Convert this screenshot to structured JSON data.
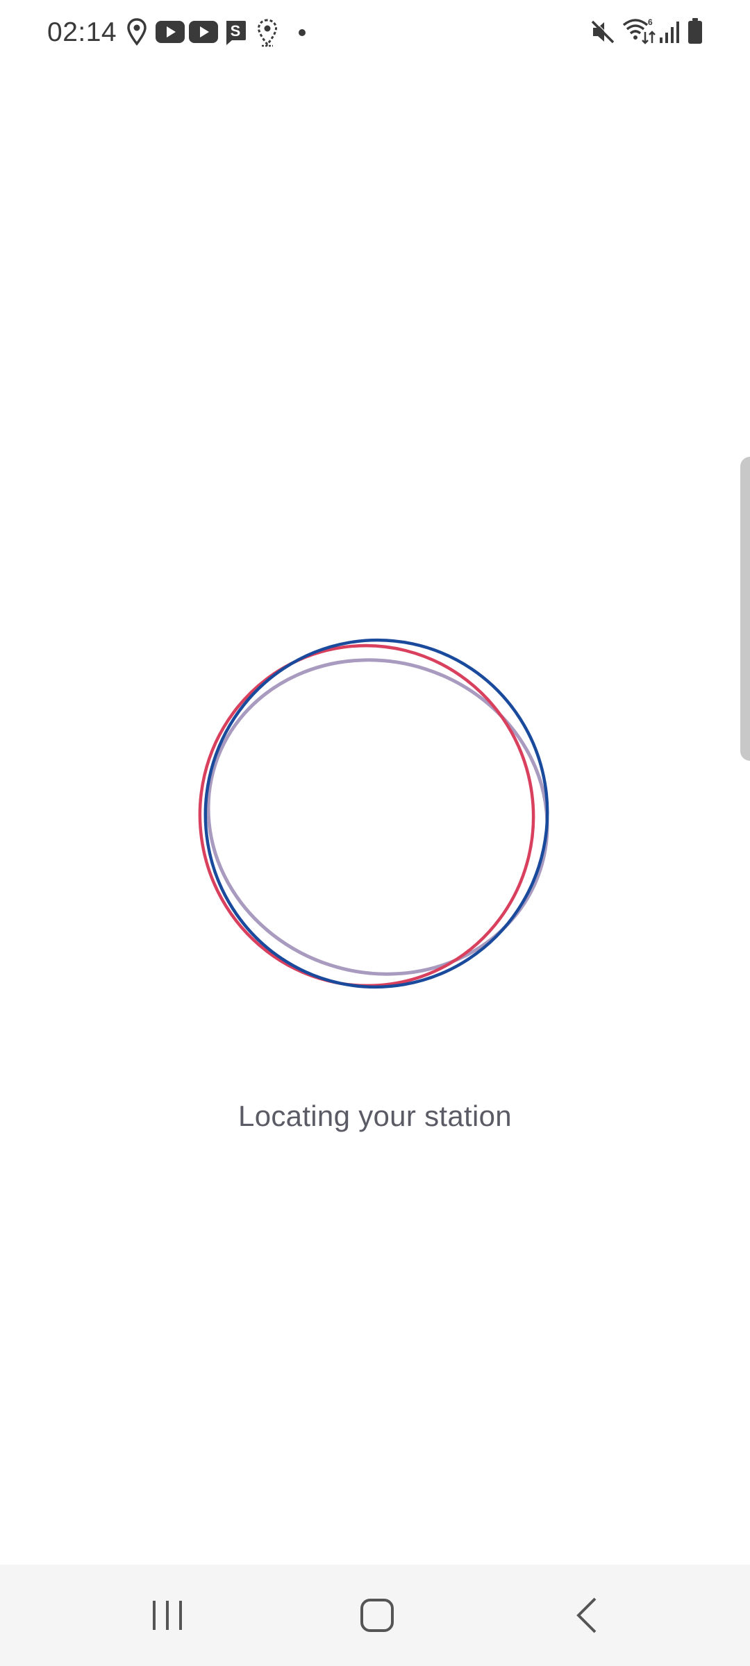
{
  "status_bar": {
    "time": "02:14",
    "left_icons": [
      "location-pin-icon",
      "youtube-icon",
      "youtube-icon",
      "s-app-icon",
      "location-dotted-icon",
      "dot-icon"
    ],
    "right_icons": [
      "mute-icon",
      "wifi-icon",
      "signal-icon",
      "battery-icon"
    ]
  },
  "main": {
    "loading_text": "Locating your station"
  },
  "loader": {
    "colors": {
      "blue": "#1a4a9c",
      "red": "#d8405e",
      "lavender": "#a89bbf"
    }
  },
  "nav_bar": {
    "buttons": [
      "recent-apps",
      "home",
      "back"
    ]
  }
}
